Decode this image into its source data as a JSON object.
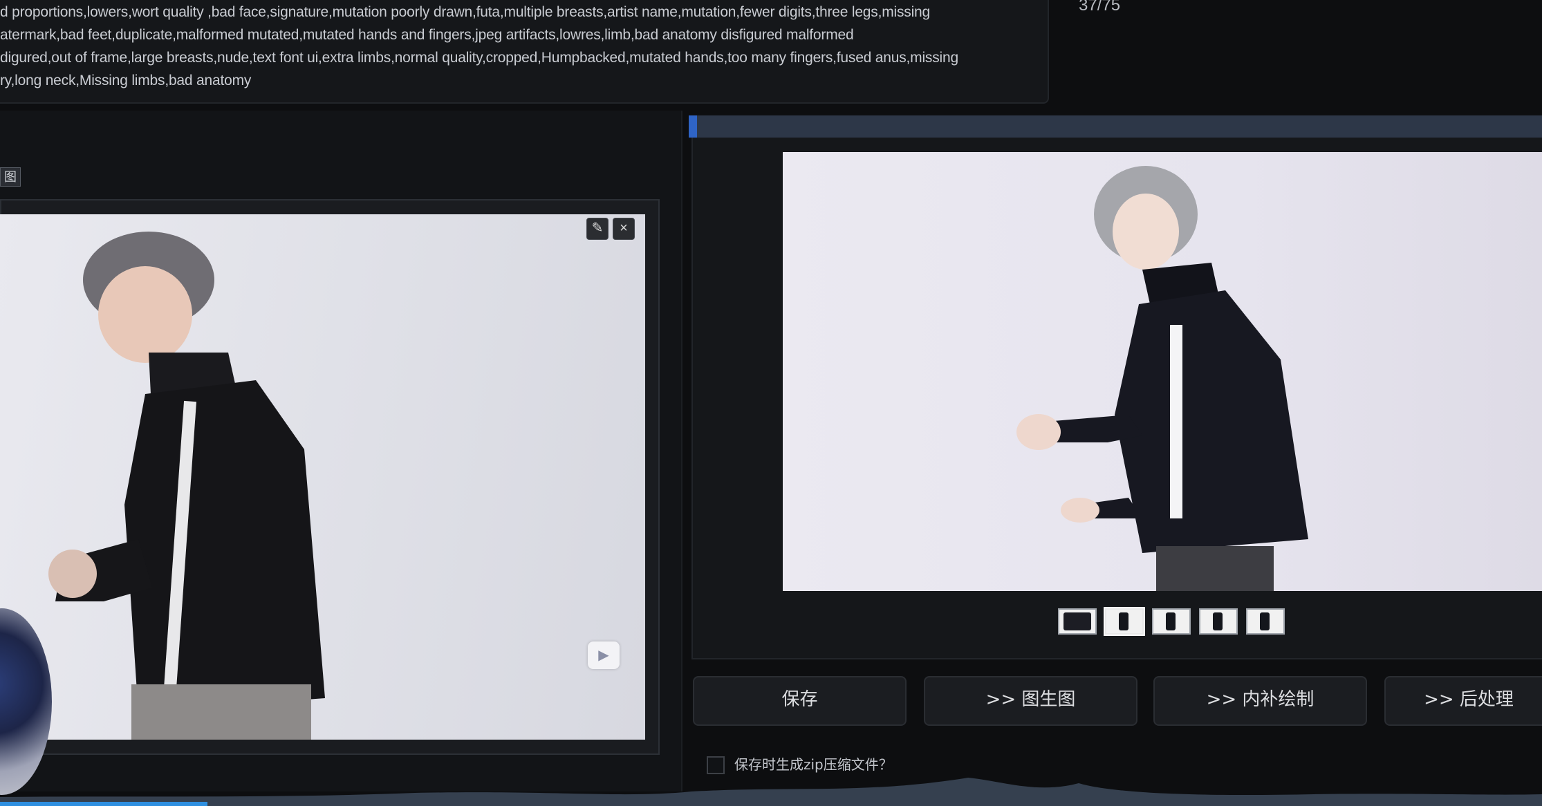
{
  "negative_prompt": {
    "lines": [
      "d proportions,lowers,wort quality ,bad face,signature,mutation poorly drawn,futa,multiple breasts,artist name,mutation,fewer digits,three legs,missing",
      "atermark,bad feet,duplicate,malformed mutated,mutated hands and fingers,jpeg artifacts,lowres,limb,bad anatomy disfigured malformed",
      "digured,out of frame,large breasts,nude,text font ui,extra limbs,normal quality,cropped,Humpbacked,mutated hands,too many fingers,fused anus,missing",
      "ry,long neck,Missing limbs,bad anatomy"
    ]
  },
  "progress": {
    "count_text": "37/75",
    "fraction": 0.49
  },
  "input_image": {
    "tab_label": "图",
    "edit_icon": "pencil-icon",
    "clear_icon": "close-icon",
    "webcam_icon": "camera-icon"
  },
  "gallery": {
    "thumbnail_count": 5,
    "selected_index": 1
  },
  "actions": {
    "save_label": "保存",
    "img2img_label": ">> 图生图",
    "inpaint_label": ">> 内补绘制",
    "extras_label": ">> 后处理"
  },
  "options": {
    "zip_label": "保存时生成zip压缩文件？",
    "zip_checked": false
  },
  "colors": {
    "progress_fill": "#2f64c6",
    "progress_track": "#2d3748",
    "background": "#0d0e10"
  }
}
